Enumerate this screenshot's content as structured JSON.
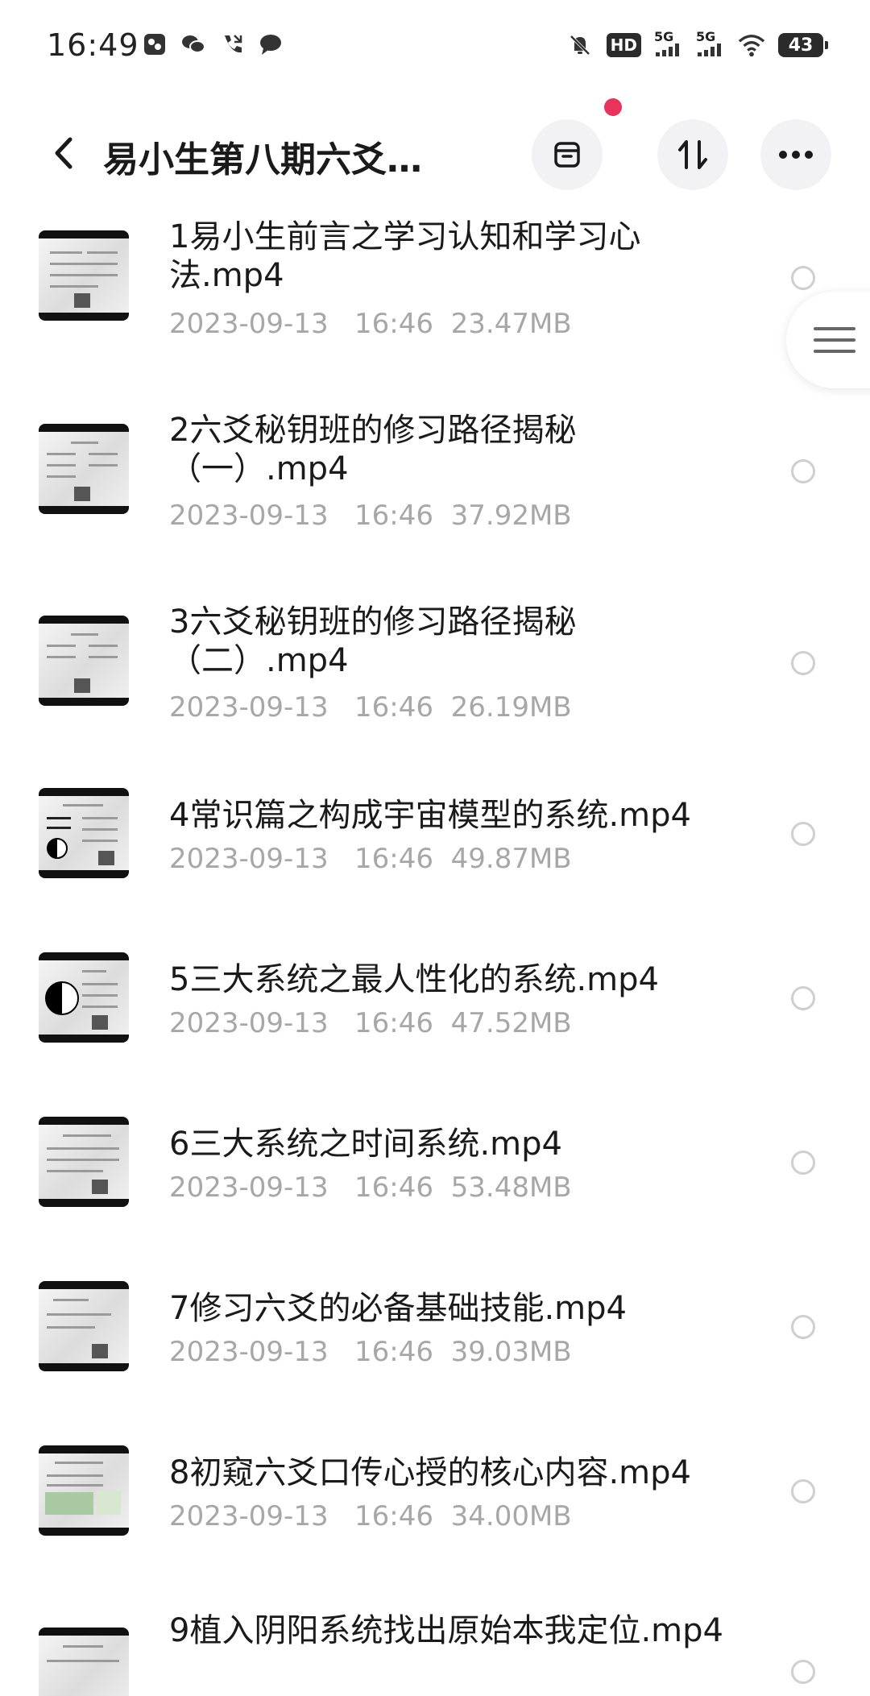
{
  "status": {
    "time": "16:49",
    "hd": "HD",
    "net1": "5G",
    "net2": "5G",
    "battery": "43"
  },
  "header": {
    "title": "易小生第八期六爻…",
    "back_icon": "chevron-left-icon",
    "buttons": [
      "archive-icon",
      "sort-icon",
      "more-icon"
    ],
    "badge_color": "#e8335a"
  },
  "files": [
    {
      "name": "1易小生前言之学习认知和学习心法.mp4",
      "date": "2023-09-13",
      "time": "16:46",
      "size": "23.47MB"
    },
    {
      "name": "2六爻秘钥班的修习路径揭秘（一）.mp4",
      "date": "2023-09-13",
      "time": "16:46",
      "size": "37.92MB"
    },
    {
      "name": "3六爻秘钥班的修习路径揭秘（二）.mp4",
      "date": "2023-09-13",
      "time": "16:46",
      "size": "26.19MB"
    },
    {
      "name": "4常识篇之构成宇宙模型的系统.mp4",
      "date": "2023-09-13",
      "time": "16:46",
      "size": "49.87MB"
    },
    {
      "name": "5三大系统之最人性化的系统.mp4",
      "date": "2023-09-13",
      "time": "16:46",
      "size": "47.52MB"
    },
    {
      "name": "6三大系统之时间系统.mp4",
      "date": "2023-09-13",
      "time": "16:46",
      "size": "53.48MB"
    },
    {
      "name": "7修习六爻的必备基础技能.mp4",
      "date": "2023-09-13",
      "time": "16:46",
      "size": "39.03MB"
    },
    {
      "name": "8初窥六爻口传心授的核心内容.mp4",
      "date": "2023-09-13",
      "time": "16:46",
      "size": "34.00MB"
    },
    {
      "name": "9植入阴阳系统找出原始本我定位.mp4",
      "date": "",
      "time": "",
      "size": ""
    }
  ]
}
